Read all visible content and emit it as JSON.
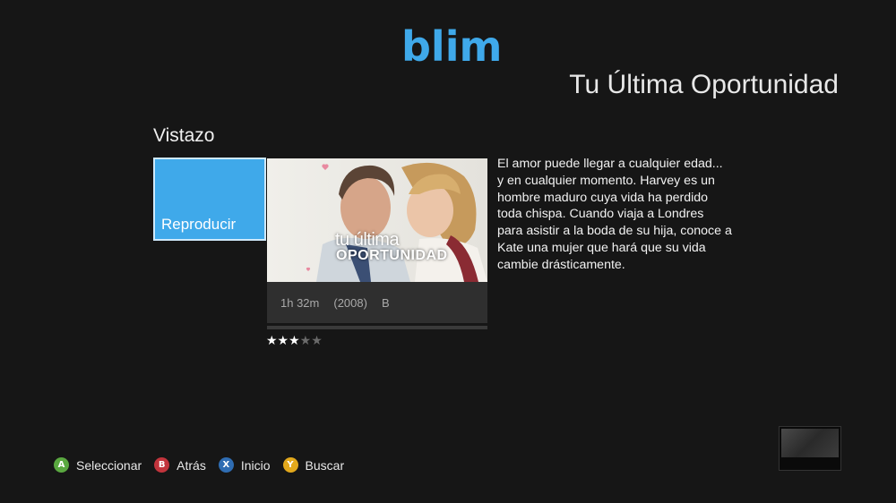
{
  "app": {
    "logo_text": "blim",
    "accent_color": "#3fa9ea"
  },
  "header": {
    "title": "Tu Última Oportunidad"
  },
  "section": {
    "title": "Vistazo"
  },
  "play_tile": {
    "label": "Reproducir"
  },
  "poster": {
    "title_line1": "tu última",
    "title_line2": "OPORTUNIDAD"
  },
  "meta": {
    "duration": "1h 32m",
    "year": "(2008)",
    "rating_class": "B"
  },
  "rating": {
    "stars_filled": 3,
    "stars_total": 5,
    "filled_glyph": "★★★",
    "empty_glyph": "★★"
  },
  "synopsis": {
    "text": "El amor puede llegar a cualquier edad... y en cualquier momento. Harvey es un hombre maduro cuya vida ha perdido toda chispa. Cuando viaja a Londres para asistir a la boda de su hija, conoce a Kate una mujer que hará que su vida cambie drásticamente."
  },
  "hints": [
    {
      "button": "A",
      "label": "Seleccionar",
      "color": "#5aa840"
    },
    {
      "button": "B",
      "label": "Atrás",
      "color": "#c2343c"
    },
    {
      "button": "X",
      "label": "Inicio",
      "color": "#2f6db3"
    },
    {
      "button": "Y",
      "label": "Buscar",
      "color": "#e2a81c"
    }
  ]
}
